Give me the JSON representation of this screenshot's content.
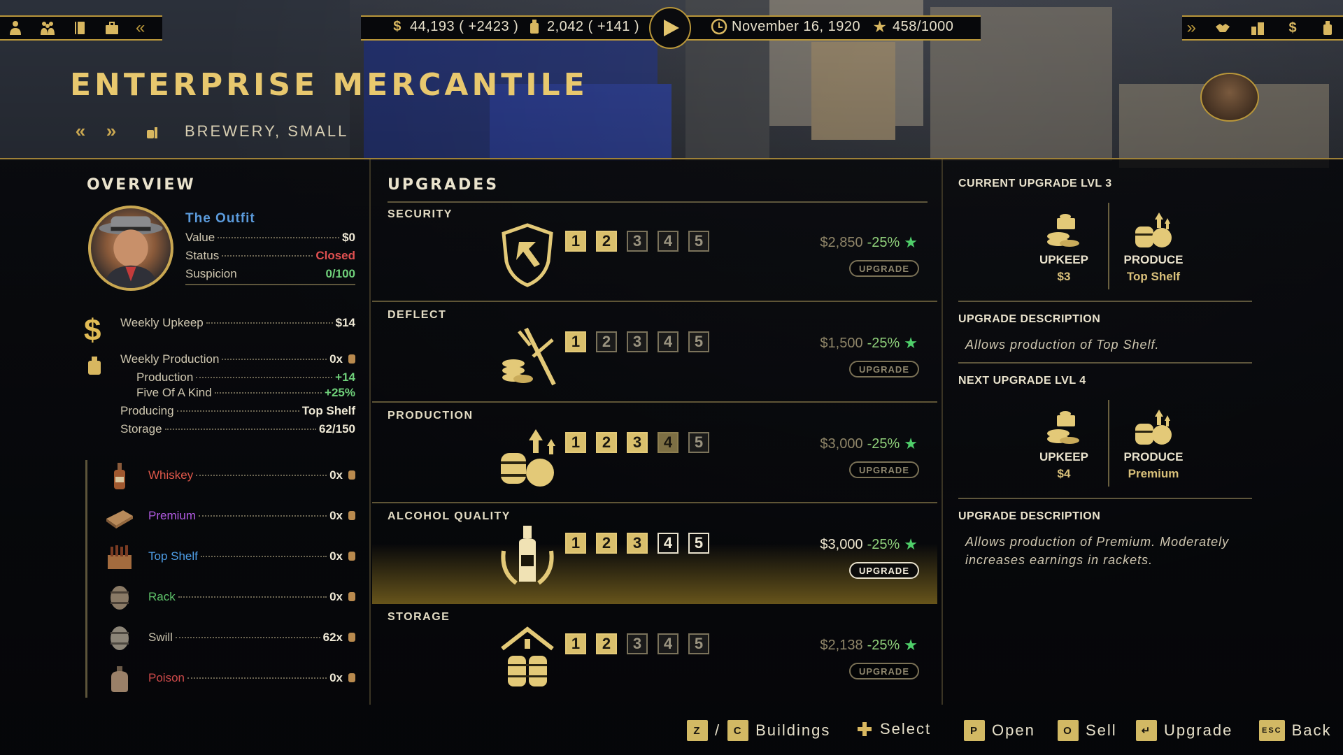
{
  "topbar": {
    "money": "44,193 ( +2423 )",
    "alcohol": "2,042 ( +141 )",
    "date": "November 16, 1920",
    "reputation": "458/1000"
  },
  "header": {
    "title": "ENTERPRISE MERCANTILE",
    "subtitle": "BREWERY, SMALL"
  },
  "overview": {
    "title": "OVERVIEW",
    "faction": "The Outfit",
    "value_label": "Value",
    "value": "$0",
    "status_label": "Status",
    "status": "Closed",
    "suspicion_label": "Suspicion",
    "suspicion": "0/100",
    "weekly_upkeep_label": "Weekly Upkeep",
    "weekly_upkeep": "$14",
    "weekly_production_label": "Weekly Production",
    "weekly_production": "0x",
    "production_label": "Production",
    "production": "+14",
    "five_kind_label": "Five Of A Kind",
    "five_kind": "+25%",
    "producing_label": "Producing",
    "producing": "Top Shelf",
    "storage_label": "Storage",
    "storage": "62/150",
    "drinks": [
      {
        "name": "Whiskey",
        "value": "0x",
        "color": "#e0584a"
      },
      {
        "name": "Premium",
        "value": "0x",
        "color": "#b05ae0"
      },
      {
        "name": "Top Shelf",
        "value": "0x",
        "color": "#4f9fe8"
      },
      {
        "name": "Rack",
        "value": "0x",
        "color": "#5fc46b"
      },
      {
        "name": "Swill",
        "value": "62x",
        "color": "#c9c2ad"
      },
      {
        "name": "Poison",
        "value": "0x",
        "color": "#d04a4a"
      }
    ]
  },
  "upgrades": {
    "title": "UPGRADES",
    "button_label": "UPGRADE",
    "rows": [
      {
        "name": "SECURITY",
        "price": "$2,850",
        "discount": "-25%",
        "level": 2
      },
      {
        "name": "DEFLECT",
        "price": "$1,500",
        "discount": "-25%",
        "level": 1
      },
      {
        "name": "PRODUCTION",
        "price": "$3,000",
        "discount": "-25%",
        "level": 4
      },
      {
        "name": "ALCOHOL QUALITY",
        "price": "$3,000",
        "discount": "-25%",
        "level": 3
      },
      {
        "name": "STORAGE",
        "price": "$2,138",
        "discount": "-25%",
        "level": 2
      }
    ],
    "levels": [
      "1",
      "2",
      "3",
      "4",
      "5"
    ]
  },
  "current": {
    "title": "CURRENT UPGRADE LVL 3",
    "upkeep_label": "UPKEEP",
    "upkeep": "$3",
    "produce_label": "PRODUCE",
    "produce": "Top Shelf",
    "desc_title": "UPGRADE DESCRIPTION",
    "desc": "Allows production of Top Shelf."
  },
  "next": {
    "title": "NEXT UPGRADE LVL 4",
    "upkeep_label": "UPKEEP",
    "upkeep": "$4",
    "produce_label": "PRODUCE",
    "produce": "Premium",
    "desc_title": "UPGRADE DESCRIPTION",
    "desc": "Allows production of Premium. Moderately increases earnings in rackets."
  },
  "bottombar": {
    "key_z": "Z",
    "slash": "/",
    "key_c": "C",
    "buildings": "Buildings",
    "select": "Select",
    "key_p": "P",
    "open": "Open",
    "key_o": "O",
    "sell": "Sell",
    "upgrade": "Upgrade",
    "key_esc": "ESC",
    "back": "Back"
  },
  "colors": {
    "gold": "#d9bf6c",
    "accent_green": "#4fcf6a",
    "closed_red": "#e05050"
  }
}
